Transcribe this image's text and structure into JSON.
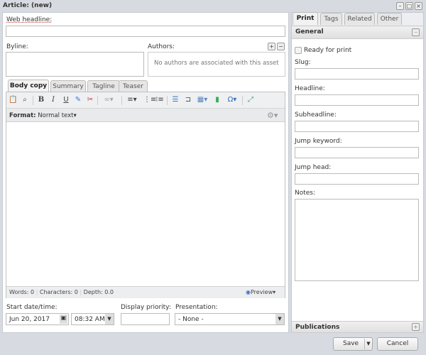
{
  "window": {
    "title": "Article: (new)"
  },
  "left": {
    "web_headline_label": "Web headline:",
    "byline_label": "Byline:",
    "authors_label": "Authors:",
    "authors_empty": "No authors are associated with this asset",
    "tabs": [
      {
        "label": "Body copy"
      },
      {
        "label": "Summary"
      },
      {
        "label": "Tagline"
      },
      {
        "label": "Teaser"
      }
    ],
    "format_label": "Format:",
    "format_value": "Normal text",
    "status": {
      "words": "Words: 0",
      "characters": "Characters: 0",
      "depth": "Depth: 0.0"
    },
    "preview_label": "Preview",
    "start_label": "Start date/time:",
    "date_value": "Jun 20, 2017",
    "time_value": "08:32 AM",
    "priority_label": "Display priority:",
    "presentation_label": "Presentation:",
    "presentation_value": "- None -"
  },
  "right": {
    "tabs": [
      {
        "label": "Print"
      },
      {
        "label": "Tags"
      },
      {
        "label": "Related"
      },
      {
        "label": "Other"
      }
    ],
    "general_header": "General",
    "ready_label": "Ready for print",
    "slug_label": "Slug:",
    "headline_label": "Headline:",
    "subheadline_label": "Subheadline:",
    "jump_keyword_label": "Jump keyword:",
    "jump_head_label": "Jump head:",
    "notes_label": "Notes:",
    "publications_header": "Publications"
  },
  "footer": {
    "save": "Save",
    "cancel": "Cancel"
  }
}
